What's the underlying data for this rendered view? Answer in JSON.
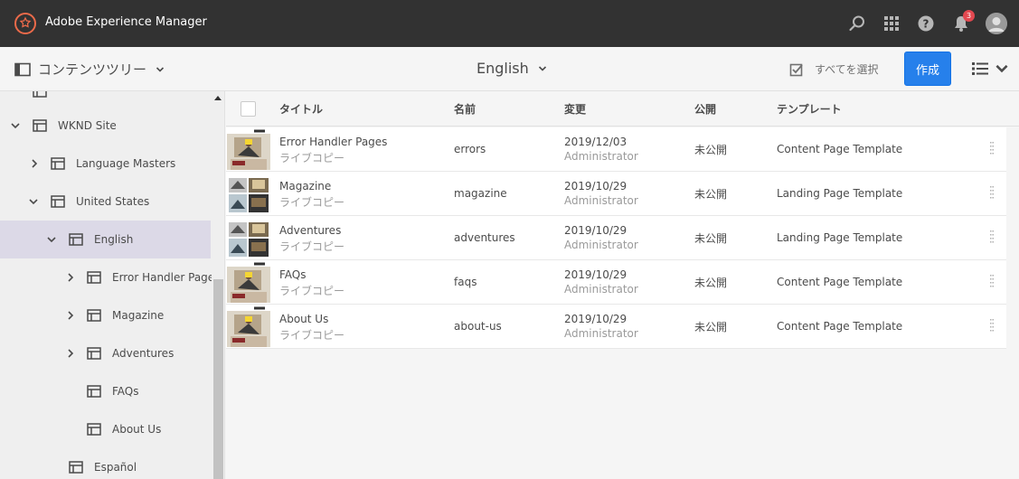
{
  "app": {
    "title": "Adobe Experience Manager",
    "notification_count": "3"
  },
  "actionbar": {
    "rail_label": "コンテンツツリー",
    "current_location": "English",
    "select_all_label": "すべてを選択",
    "create_label": "作成"
  },
  "tree": {
    "items": [
      {
        "label": "WKND Site"
      },
      {
        "label": "Language Masters"
      },
      {
        "label": "United States"
      },
      {
        "label": "English"
      },
      {
        "label": "Error Handler Pages"
      },
      {
        "label": "Magazine"
      },
      {
        "label": "Adventures"
      },
      {
        "label": "FAQs"
      },
      {
        "label": "About Us"
      },
      {
        "label": "Español"
      }
    ]
  },
  "table": {
    "headers": {
      "title": "タイトル",
      "name": "名前",
      "modified": "変更",
      "published": "公開",
      "template": "テンプレート"
    },
    "rows": [
      {
        "title": "Error Handler Pages",
        "subtitle": "ライブコピー",
        "name": "errors",
        "modified_date": "2019/12/03",
        "modified_by": "Administrator",
        "published": "未公開",
        "template": "Content Page Template",
        "thumbnail": "content-page"
      },
      {
        "title": "Magazine",
        "subtitle": "ライブコピー",
        "name": "magazine",
        "modified_date": "2019/10/29",
        "modified_by": "Administrator",
        "published": "未公開",
        "template": "Landing Page Template",
        "thumbnail": "landing-page"
      },
      {
        "title": "Adventures",
        "subtitle": "ライブコピー",
        "name": "adventures",
        "modified_date": "2019/10/29",
        "modified_by": "Administrator",
        "published": "未公開",
        "template": "Landing Page Template",
        "thumbnail": "landing-page"
      },
      {
        "title": "FAQs",
        "subtitle": "ライブコピー",
        "name": "faqs",
        "modified_date": "2019/10/29",
        "modified_by": "Administrator",
        "published": "未公開",
        "template": "Content Page Template",
        "thumbnail": "content-page"
      },
      {
        "title": "About Us",
        "subtitle": "ライブコピー",
        "name": "about-us",
        "modified_date": "2019/10/29",
        "modified_by": "Administrator",
        "published": "未公開",
        "template": "Content Page Template",
        "thumbnail": "content-page"
      }
    ]
  },
  "colors": {
    "topbar": "#323232",
    "accent": "#2680eb",
    "brand": "#eb6a4a",
    "selected_row": "#dcd9e7",
    "badge": "#e34850"
  }
}
